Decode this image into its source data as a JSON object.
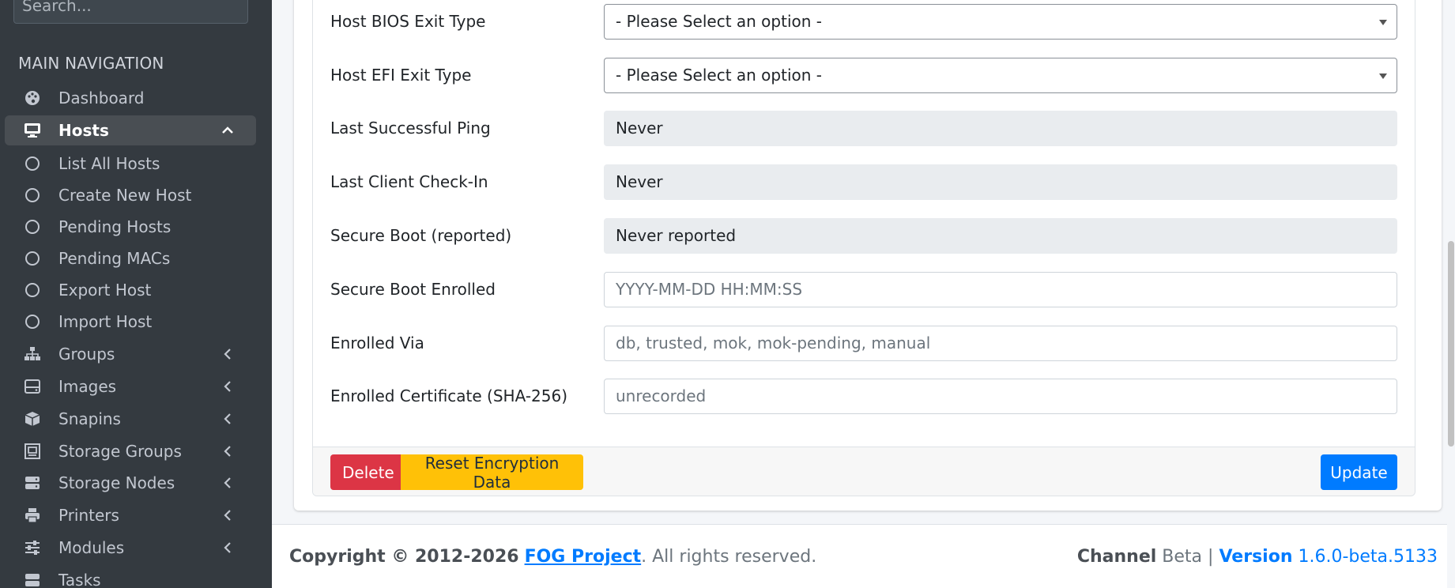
{
  "sidebar": {
    "search_placeholder": "Search...",
    "nav_header": "MAIN NAVIGATION",
    "items": [
      {
        "label": "Dashboard",
        "icon": "palette-icon"
      },
      {
        "label": "Hosts",
        "icon": "desktop-icon",
        "active": true
      },
      {
        "label": "List All Hosts",
        "icon": "circle-icon"
      },
      {
        "label": "Create New Host",
        "icon": "circle-icon"
      },
      {
        "label": "Pending Hosts",
        "icon": "circle-icon"
      },
      {
        "label": "Pending MACs",
        "icon": "circle-icon"
      },
      {
        "label": "Export Host",
        "icon": "circle-icon"
      },
      {
        "label": "Import Host",
        "icon": "circle-icon"
      },
      {
        "label": "Groups",
        "icon": "sitemap-icon"
      },
      {
        "label": "Images",
        "icon": "hdd-icon"
      },
      {
        "label": "Snapins",
        "icon": "box-icon"
      },
      {
        "label": "Storage Groups",
        "icon": "archive-icon"
      },
      {
        "label": "Storage Nodes",
        "icon": "server-icon"
      },
      {
        "label": "Printers",
        "icon": "printer-icon"
      },
      {
        "label": "Modules",
        "icon": "sliders-icon"
      },
      {
        "label": "Tasks",
        "icon": "tasks-icon"
      }
    ]
  },
  "form": {
    "fields": [
      {
        "label": "Host BIOS Exit Type",
        "value": "- Please Select an option -",
        "kind": "select"
      },
      {
        "label": "Host EFI Exit Type",
        "value": "- Please Select an option -",
        "kind": "select"
      },
      {
        "label": "Last Successful Ping",
        "value": "Never",
        "kind": "readonly"
      },
      {
        "label": "Last Client Check-In",
        "value": "Never",
        "kind": "readonly"
      },
      {
        "label": "Secure Boot (reported)",
        "value": "Never reported",
        "kind": "readonly"
      },
      {
        "label": "Secure Boot Enrolled",
        "placeholder": "YYYY-MM-DD HH:MM:SS",
        "kind": "input"
      },
      {
        "label": "Enrolled Via",
        "placeholder": "db, trusted, mok, mok-pending, manual",
        "kind": "input"
      },
      {
        "label": "Enrolled Certificate (SHA-256)",
        "placeholder": "unrecorded",
        "kind": "input"
      }
    ]
  },
  "actions": {
    "delete_label": "Delete",
    "reset_label": "Reset Encryption Data",
    "update_label": "Update"
  },
  "footer": {
    "copyright_prefix": "Copyright © 2012-2026",
    "project_link": "FOG Project",
    "suffix": ". All rights reserved.",
    "channel_label": "Channel",
    "channel_value": "Beta",
    "separator": "|",
    "version_label": "Version",
    "version_value": "1.6.0-beta.5133"
  },
  "colors": {
    "sidebar_bg": "#343a40",
    "danger": "#dc3545",
    "warning": "#ffc107",
    "primary": "#007bff"
  }
}
